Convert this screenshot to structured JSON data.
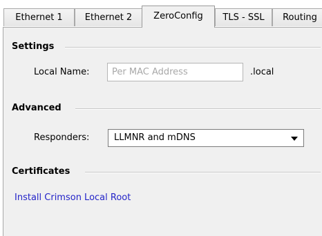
{
  "tabs": [
    {
      "label": "Ethernet 1",
      "active": false
    },
    {
      "label": "Ethernet 2",
      "active": false
    },
    {
      "label": "ZeroConfig",
      "active": true
    },
    {
      "label": "TLS - SSL",
      "active": false
    },
    {
      "label": "Routing",
      "active": false
    }
  ],
  "settings": {
    "header": "Settings",
    "local_name_label": "Local Name:",
    "local_name_placeholder": "Per MAC Address",
    "local_name_value": "",
    "suffix": ".local"
  },
  "advanced": {
    "header": "Advanced",
    "responders_label": "Responders:",
    "responders_value": "LLMNR and mDNS"
  },
  "certificates": {
    "header": "Certificates",
    "install_link": "Install Crimson Local Root"
  }
}
